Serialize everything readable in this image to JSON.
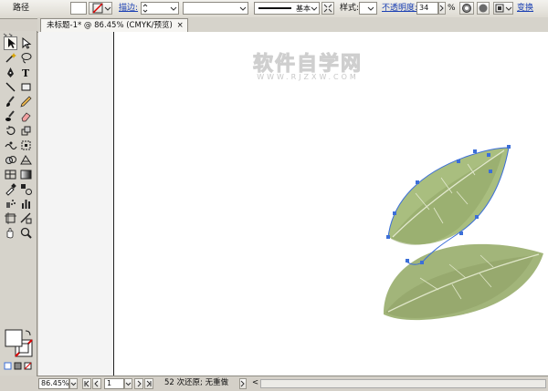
{
  "control_bar": {
    "title": "路径",
    "stroke_label": "描边:",
    "stroke_width": "",
    "brush_label": "基本",
    "style_label": "样式:",
    "opacity_label": "不透明度:",
    "opacity_value": "34",
    "percent": "%",
    "transform_label": "变换"
  },
  "document": {
    "tab_title": "未标题-1* @ 86.45% (CMYK/预览)",
    "close_glyph": "×"
  },
  "watermark": {
    "title": "软件自学网",
    "url": "WWW.RJZXW.COM"
  },
  "status_bar": {
    "zoom": "86.45%",
    "page": "1",
    "message": "52 次还原; 无重做",
    "arrow": "<"
  },
  "colors": {
    "ui_bg": "#d4d0c8",
    "link_blue": "#1a3fb3",
    "leaf_light": "#b9c99a",
    "leaf_dark": "#86985a",
    "selection_blue": "#3c6fd8"
  },
  "icons": [
    "selection-icon",
    "direct-selection-icon",
    "magic-wand-icon",
    "lasso-icon",
    "pen-icon",
    "type-icon",
    "line-icon",
    "rectangle-icon",
    "paintbrush-icon",
    "pencil-icon",
    "blob-brush-icon",
    "eraser-icon",
    "rotate-icon",
    "scale-icon",
    "warp-icon",
    "free-transform-icon",
    "shape-builder-icon",
    "perspective-icon",
    "mesh-icon",
    "gradient-icon",
    "eyedropper-icon",
    "blend-icon",
    "symbol-sprayer-icon",
    "column-graph-icon",
    "artboard-icon",
    "slice-icon",
    "hand-icon",
    "zoom-icon"
  ]
}
